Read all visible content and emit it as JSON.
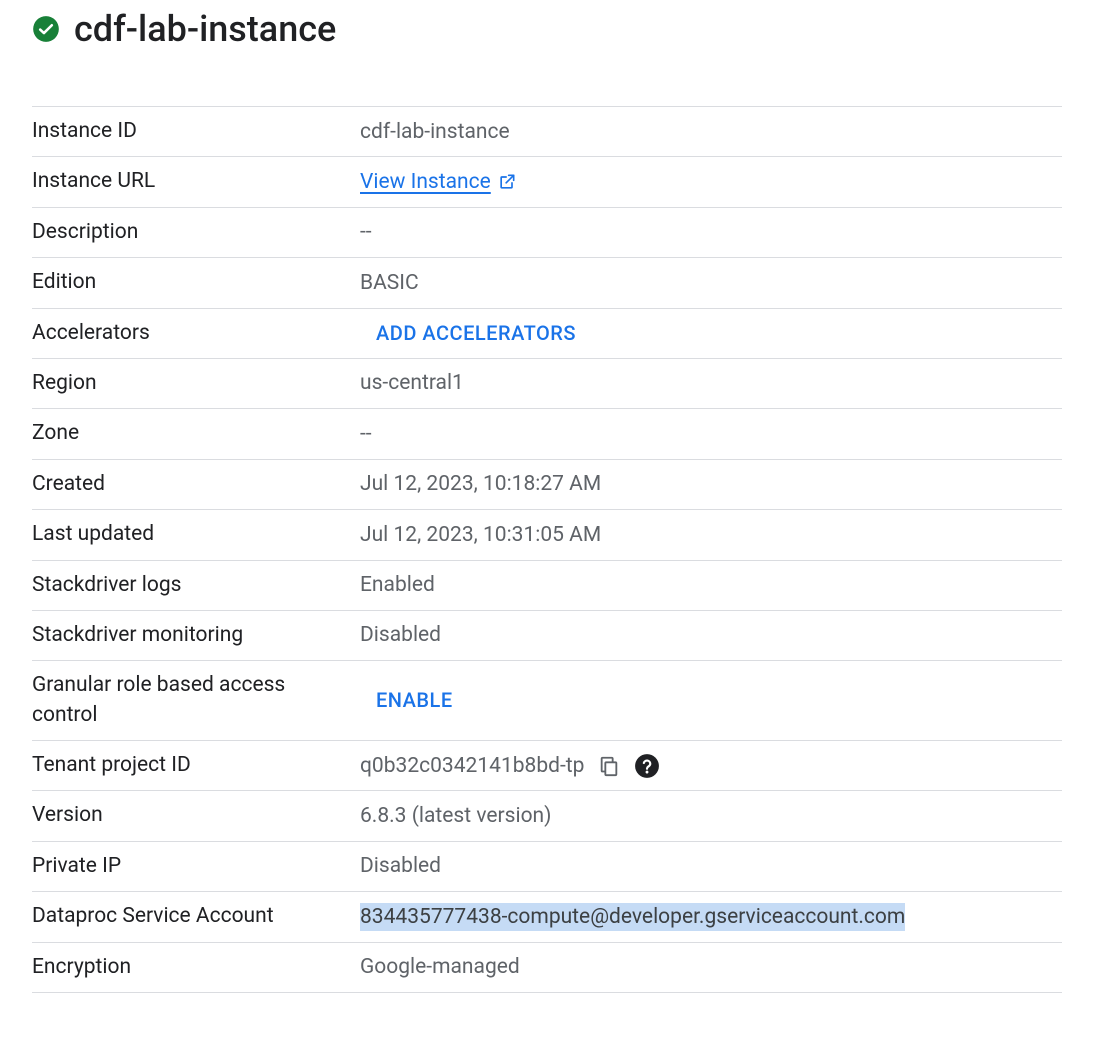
{
  "header": {
    "title": "cdf-lab-instance"
  },
  "details": {
    "instance_id": {
      "label": "Instance ID",
      "value": "cdf-lab-instance"
    },
    "instance_url": {
      "label": "Instance URL",
      "link_text": "View Instance"
    },
    "description": {
      "label": "Description",
      "value": "--"
    },
    "edition": {
      "label": "Edition",
      "value": "BASIC"
    },
    "accelerators": {
      "label": "Accelerators",
      "action": "ADD ACCELERATORS"
    },
    "region": {
      "label": "Region",
      "value": "us-central1"
    },
    "zone": {
      "label": "Zone",
      "value": "--"
    },
    "created": {
      "label": "Created",
      "value": "Jul 12, 2023, 10:18:27 AM"
    },
    "last_updated": {
      "label": "Last updated",
      "value": "Jul 12, 2023, 10:31:05 AM"
    },
    "stackdriver_logs": {
      "label": "Stackdriver logs",
      "value": "Enabled"
    },
    "stackdriver_monitoring": {
      "label": "Stackdriver monitoring",
      "value": "Disabled"
    },
    "rbac": {
      "label": "Granular role based access control",
      "action": "ENABLE"
    },
    "tenant_project_id": {
      "label": "Tenant project ID",
      "value": "q0b32c0342141b8bd-tp"
    },
    "version": {
      "label": "Version",
      "value": "6.8.3 (latest version)"
    },
    "private_ip": {
      "label": "Private IP",
      "value": "Disabled"
    },
    "dataproc_sa": {
      "label": "Dataproc Service Account",
      "value": "834435777438-compute@developer.gserviceaccount.com"
    },
    "encryption": {
      "label": "Encryption",
      "value": "Google-managed"
    }
  }
}
